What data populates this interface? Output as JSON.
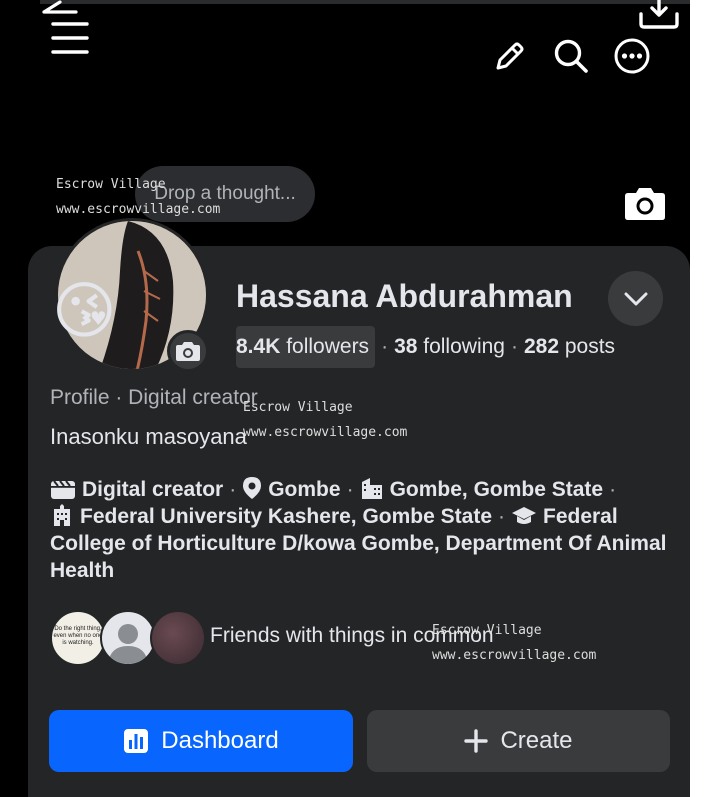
{
  "header": {
    "back_icon": "arrow-left-icon",
    "menu_icon": "hamburger-icon",
    "download_icon": "download-icon",
    "edit_icon": "pencil-icon",
    "search_icon": "search-icon",
    "more_icon": "more-horizontal-icon"
  },
  "thought_bubble": {
    "placeholder": "Drop a thought..."
  },
  "watermarks": [
    {
      "line1": "Escrow Village",
      "line2": "www.escrowvillage.com"
    },
    {
      "line1": "Escrow Village",
      "line2": "www.escrowvillage.com"
    },
    {
      "line1": "Escrow Village",
      "line2": "www.escrowvillage.com"
    }
  ],
  "profile": {
    "name": "Hassana Abdurahman",
    "avatar_emoji": "😘",
    "stats": {
      "followers_count": "8.4K",
      "followers_label": " followers",
      "following_count": "38",
      "following_label": " following",
      "posts_count": "282",
      "posts_label": " posts",
      "separator": "·"
    },
    "category_line": "Profile · Digital creator",
    "bio": "Inasonku masoyana"
  },
  "details": {
    "creator": "Digital creator",
    "location": "Gombe",
    "city": "Gombe, Gombe State",
    "education_1": "Federal University Kashere, Gombe State",
    "education_2": "Federal College of Horticulture D/kowa Gombe, Department Of Animal Health"
  },
  "mutual": {
    "text": "Friends with things in common",
    "avatar1_caption": "Do the right thing, even when no one is watching."
  },
  "actions": {
    "dashboard_label": "Dashboard",
    "create_label": "Create"
  },
  "colors": {
    "background": "#000000",
    "card": "#242526",
    "primary_button": "#0866ff",
    "secondary_button": "#3a3b3c",
    "text_primary": "#e4e6eb",
    "text_secondary": "#b0b3b8"
  }
}
